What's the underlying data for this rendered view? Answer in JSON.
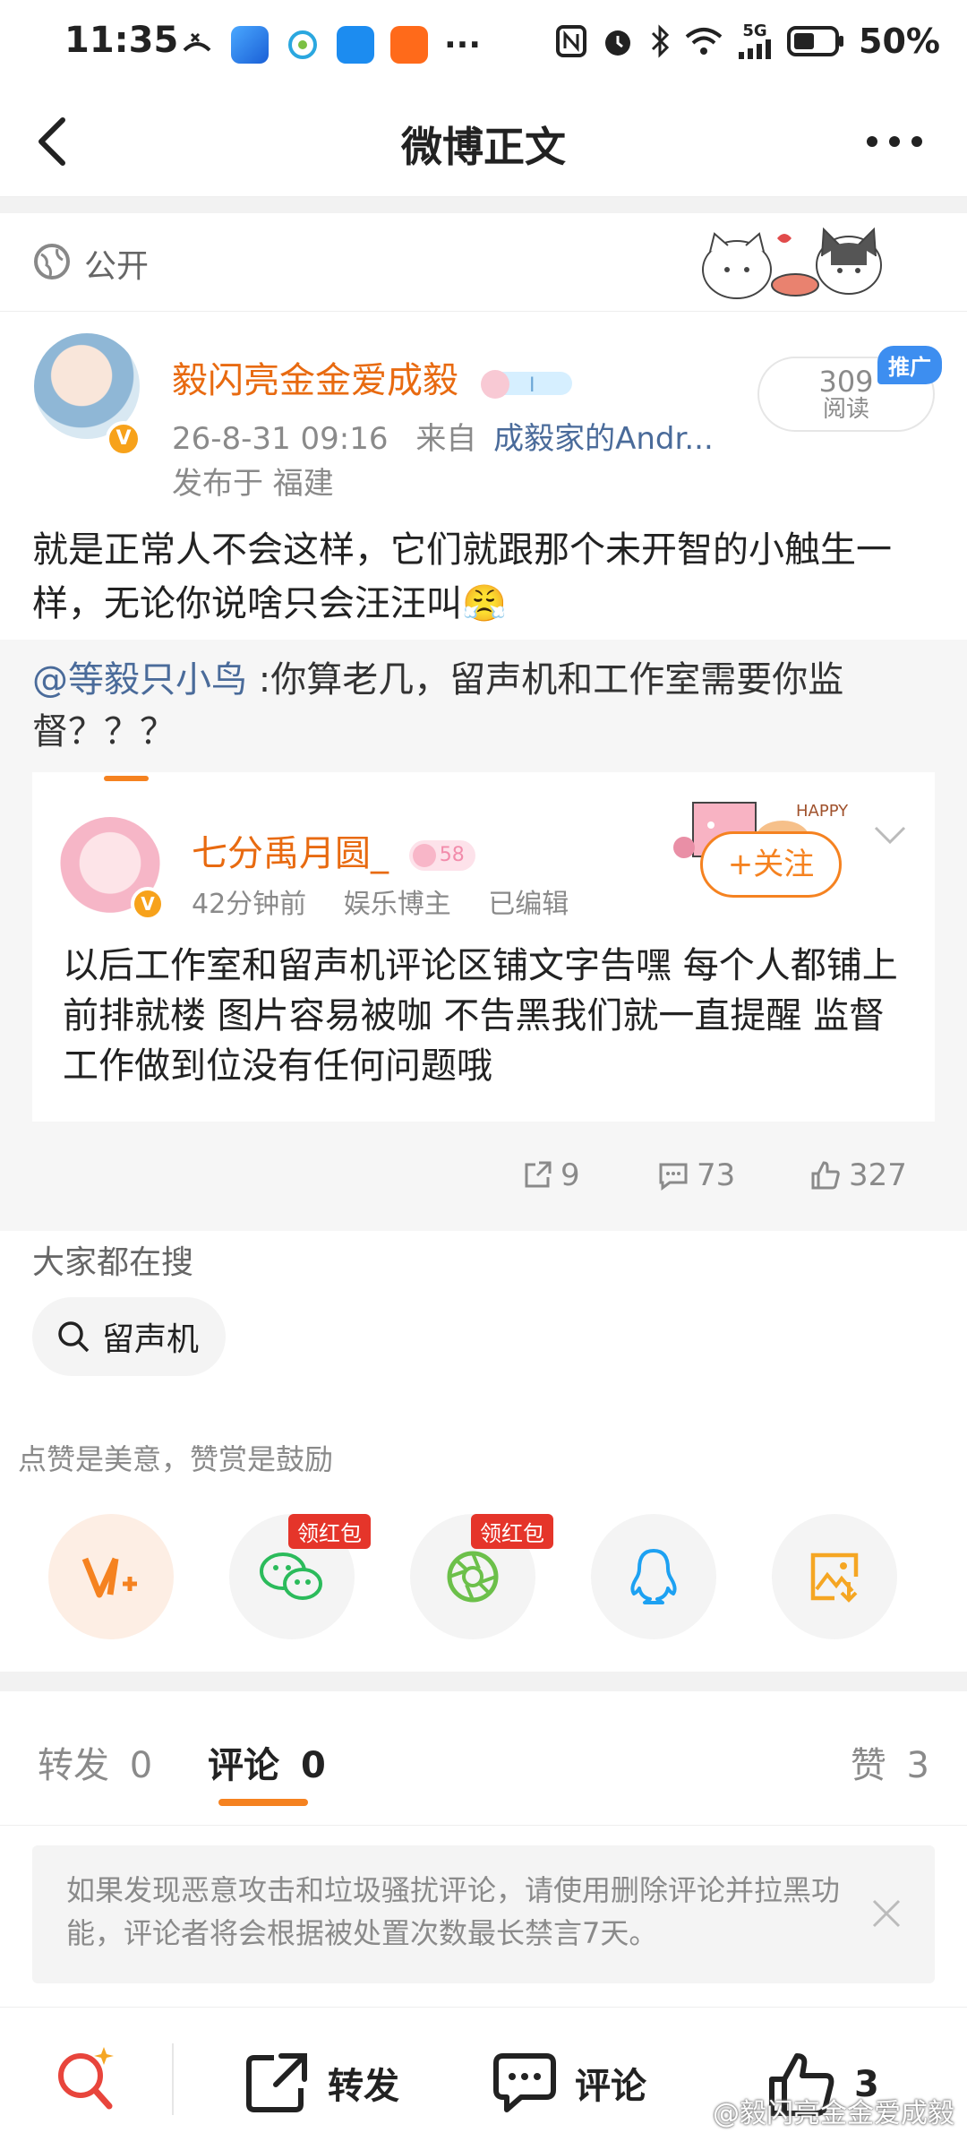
{
  "status_bar": {
    "time": "11:35",
    "more": "···",
    "network": "5G",
    "battery": "50%"
  },
  "nav": {
    "title": "微博正文"
  },
  "visibility": {
    "label": "公开"
  },
  "post": {
    "username": "毅闪亮金金爱成毅",
    "timestamp": "26-8-31 09:16",
    "from_prefix": "来自",
    "source": "成毅家的Andr...",
    "location": "发布于 福建",
    "read_count": "309",
    "read_label": "阅读",
    "ad_tag": "推广",
    "text": "就是正常人不会这样，它们就跟那个未开智的小触生一样，无论你说啥只会汪汪叫😤"
  },
  "repost": {
    "mention": "@等毅只小鸟",
    "text": " :你算老几，留声机和工作室需要你监督？？？",
    "original": {
      "username": "七分禹月圆_",
      "level": "58",
      "time": "42分钟前",
      "role": "娱乐博主",
      "edited": "已编辑",
      "follow_label": "+关注",
      "text": "以后工作室和留声机评论区铺文字告嘿 每个人都铺上前排就楼 图片容易被咖 不告黑我们就一直提醒 监督工作做到位没有任何问题哦"
    },
    "actions": {
      "reposts": "9",
      "comments": "73",
      "likes": "327"
    }
  },
  "trending": {
    "title": "大家都在搜",
    "chip": "留声机"
  },
  "reward": {
    "tip": "点赞是美意，赞赏是鼓励",
    "red_packet_1": "领红包",
    "red_packet_2": "领红包"
  },
  "tabs": {
    "repost_label": "转发",
    "repost_count": "0",
    "comment_label": "评论",
    "comment_count": "0",
    "like_label": "赞",
    "like_count": "3"
  },
  "notice": {
    "text": "如果发现恶意攻击和垃圾骚扰评论，请使用删除评论并拉黑功能，评论者将会根据被处置次数最长禁言7天。"
  },
  "bottom_bar": {
    "repost": "转发",
    "comment": "评论",
    "like_count": "3"
  },
  "watermark": "@毅闪亮金金爱成毅",
  "colors": {
    "accent_orange": "#f58220",
    "username_orange": "#e86a10",
    "link_blue": "#4a6b9a",
    "ad_blue": "#3d8ef0",
    "red_packet": "#e5352a"
  }
}
